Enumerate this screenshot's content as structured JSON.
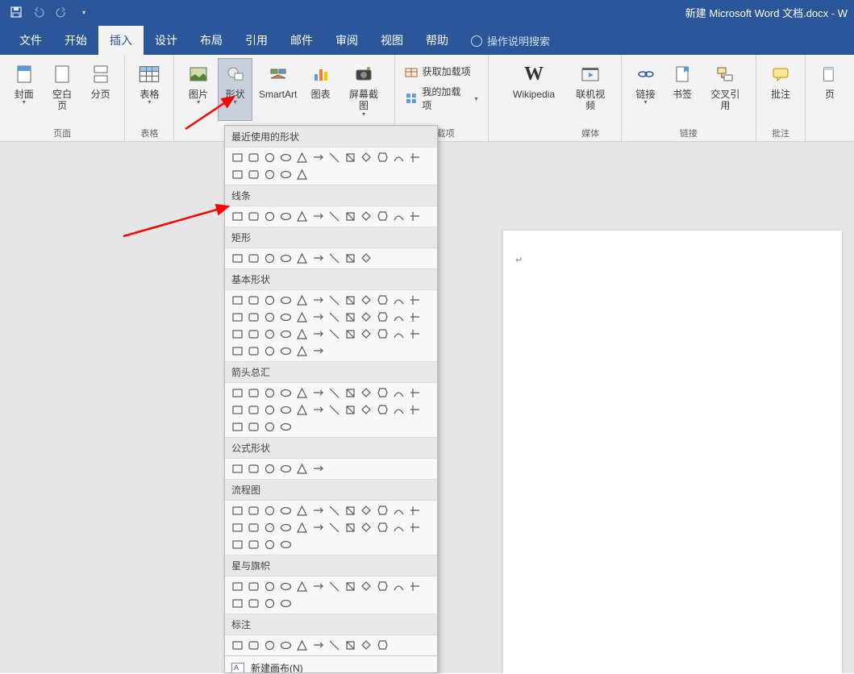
{
  "titlebar": {
    "doc_title": "新建 Microsoft Word 文档.docx  -  W"
  },
  "tabs": {
    "file": "文件",
    "home": "开始",
    "insert": "插入",
    "design": "设计",
    "layout": "布局",
    "references": "引用",
    "mailings": "邮件",
    "review": "审阅",
    "view": "视图",
    "help": "帮助",
    "tell_me": "操作说明搜索"
  },
  "ribbon": {
    "cover_page": "封面",
    "blank_page": "空白页",
    "page_break": "分页",
    "pages_group": "页面",
    "table": "表格",
    "tables_group": "表格",
    "pictures": "图片",
    "shapes": "形状",
    "smartart": "SmartArt",
    "chart": "图表",
    "screenshot": "屏幕截图",
    "get_addins": "获取加载项",
    "my_addins": "我的加载项",
    "wikipedia": "Wikipedia",
    "addins_group": "加载项",
    "online_video": "联机视频",
    "media_group": "媒体",
    "link": "链接",
    "bookmark": "书签",
    "cross_ref": "交叉引用",
    "links_group": "链接",
    "comment": "批注",
    "comments_group": "批注",
    "header": "页"
  },
  "shapes_menu": {
    "recent": "最近使用的形状",
    "lines": "线条",
    "rectangles": "矩形",
    "basic": "基本形状",
    "arrows": "箭头总汇",
    "equation": "公式形状",
    "flowchart": "流程图",
    "stars": "星与旗帜",
    "callouts": "标注",
    "new_canvas": "新建画布(N)"
  },
  "shape_counts": {
    "recent": 17,
    "lines": 12,
    "rectangles": 9,
    "basic": 42,
    "arrows": 28,
    "equation": 6,
    "flowchart": 28,
    "stars": 16,
    "callouts": 10
  }
}
